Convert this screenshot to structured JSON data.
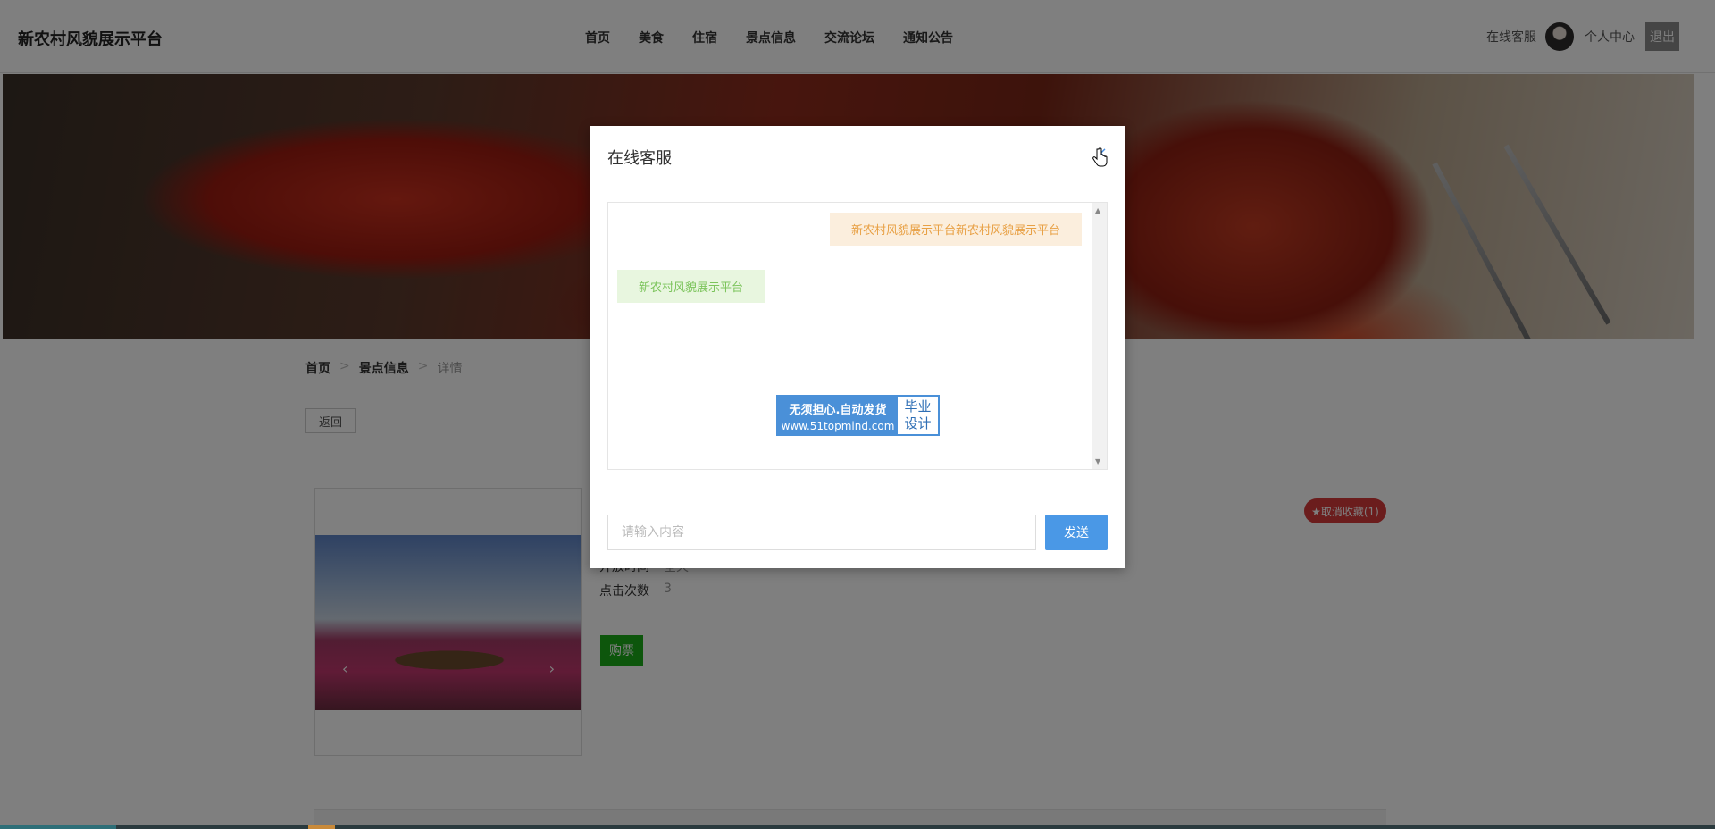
{
  "header": {
    "logo": "新农村风貌展示平台",
    "nav": [
      "首页",
      "美食",
      "住宿",
      "景点信息",
      "交流论坛",
      "通知公告"
    ],
    "customer_service": "在线客服",
    "profile": "个人中心",
    "logout": "退出"
  },
  "breadcrumb": {
    "home": "首页",
    "section": "景点信息",
    "current": "详情",
    "separator": ">"
  },
  "back_label": "返回",
  "gallery": {
    "prev_arrow": "‹",
    "next_arrow": "›"
  },
  "info": {
    "rows": [
      {
        "label": "开放时间",
        "value": "全天"
      },
      {
        "label": "点击次数",
        "value": "3"
      }
    ]
  },
  "buy_label": "购票",
  "favorite_label": "★取消收藏(1)",
  "modal": {
    "title": "在线客服",
    "close": "×",
    "messages": [
      {
        "side": "right",
        "text": "新农村风貌展示平台新农村风貌展示平台"
      },
      {
        "side": "left",
        "text": "新农村风貌展示平台"
      }
    ],
    "watermark": {
      "line1": "无须担心.自动发货",
      "line2": "www.51topmind.com",
      "right_line1": "毕业",
      "right_line2": "设计"
    },
    "input_placeholder": "请输入内容",
    "send_label": "发送"
  },
  "colors": {
    "accent": "#4a98e6",
    "buy": "#1aad19",
    "favorite": "#d63a3a",
    "bubble_right": "#e8a044",
    "bubble_left": "#7cc45c"
  }
}
